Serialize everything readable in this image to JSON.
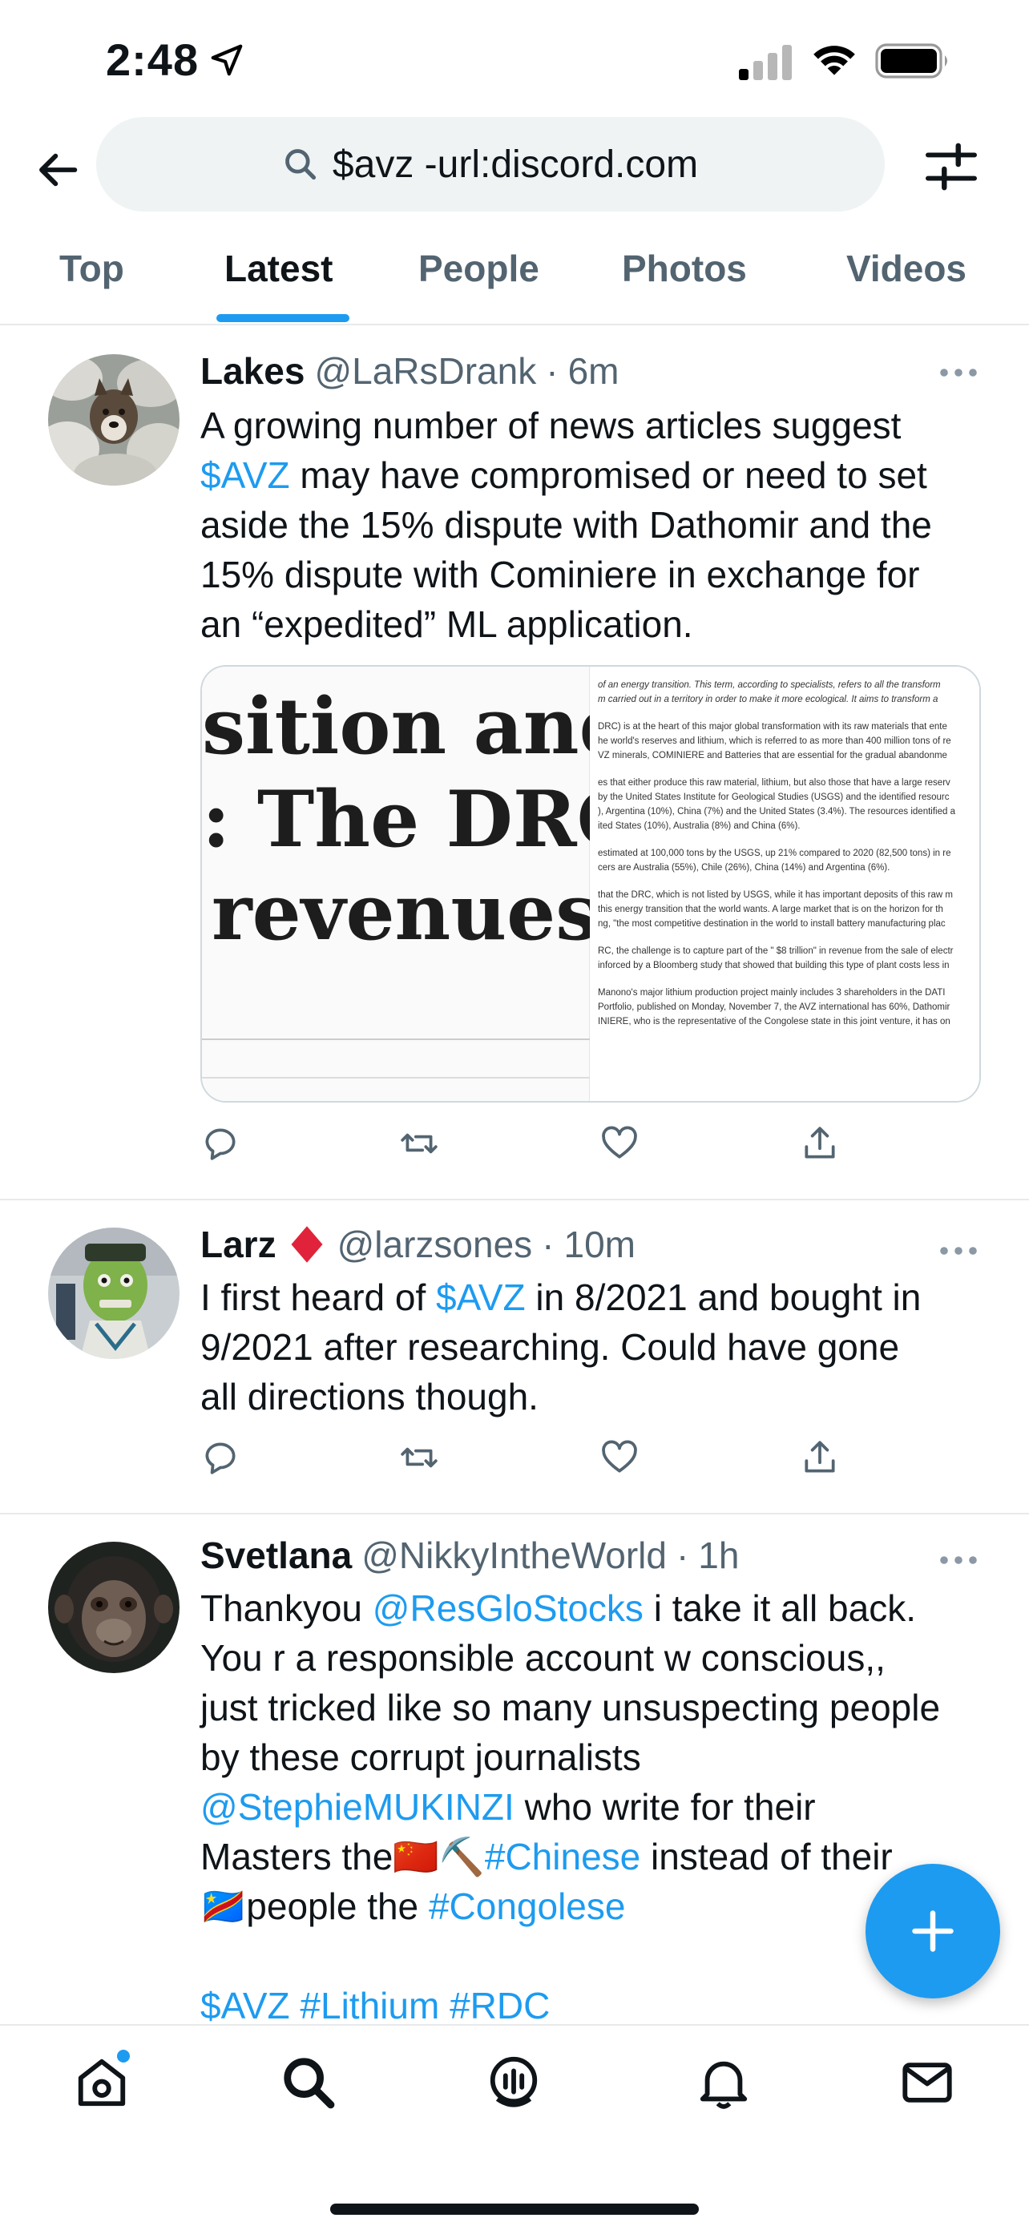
{
  "status_bar": {
    "time": "2:48",
    "icons": [
      "location-arrow-icon",
      "cellular-signal-icon",
      "wifi-icon",
      "battery-icon"
    ]
  },
  "search": {
    "query": "$avz -url:discord.com"
  },
  "tabs": [
    {
      "label": "Top",
      "active": false
    },
    {
      "label": "Latest",
      "active": true
    },
    {
      "label": "People",
      "active": false
    },
    {
      "label": "Photos",
      "active": false
    },
    {
      "label": "Videos",
      "active": false
    }
  ],
  "colors": {
    "accent": "#1d9bf0",
    "text": "#0f1419",
    "secondary": "#536471",
    "divider": "#e7e9ea",
    "search_bg": "#eff3f4"
  },
  "tweets": [
    {
      "name": "Lakes",
      "handle": "@LaRsDrank",
      "separator": "·",
      "time": "6m",
      "body": {
        "l1": "A growing number of news articles suggest",
        "l2_link": "$AVZ",
        "l2": " may have compromised or need to set",
        "l3": "aside the 15% dispute with Dathomir and the",
        "l4": "15% dispute with Cominiere in exchange for",
        "l5": "an “expedited” ML application."
      },
      "media": {
        "headline_1": "sition and",
        "headline_2": ": The DRC",
        "headline_3": "revenues",
        "article": [
          "of an energy transition. This term, according to specialists, refers to all the transform",
          "m carried out in a territory in order to make it more ecological. It aims to transform a",
          "DRC) is at the heart of this major global transformation with its raw materials that ente",
          "he world's reserves and lithium, which is referred to as more than 400 million tons of re",
          "VZ minerals, COMINIERE and Batteries that are essential for the gradual abandonme",
          "es that either produce this raw material, lithium, but also those that have a large reserv",
          "by the United States Institute for Geological Studies (USGS) and the identified resourc",
          "), Argentina (10%), China (7%) and the United States (3.4%). The resources identified a",
          "ited States (10%), Australia (8%) and China (6%).",
          "estimated at 100,000 tons by the USGS, up 21% compared to 2020 (82,500 tons) in re",
          "cers are Australia (55%), Chile (26%), China (14%) and Argentina (6%).",
          "that the DRC, which is not listed by USGS, while it has important deposits of this raw m",
          "this energy transition that the world wants. A large market that is on the horizon for th",
          "ng, \"the most competitive destination in the world to install battery manufacturing plac",
          "RC, the challenge is to capture part of the \" $8 trillion\" in revenue from the sale of electr",
          "inforced by a Bloomberg study that showed that building this type of plant costs less in",
          "Manono's major lithium production project mainly includes 3 shareholders in the DATI",
          "Portfolio, published on Monday, November 7, the AVZ international has 60%, Dathomir",
          "INIERE, who is the representative of the Congolese state in this joint venture, it has on"
        ]
      }
    },
    {
      "name": "Larz",
      "badge_emoji": "♦️",
      "handle": "@larzsones",
      "separator": "·",
      "time": "10m",
      "body": {
        "l1_pre": "I first heard of ",
        "l1_link": "$AVZ",
        "l1_post": " in 8/2021 and bought in",
        "l2": "9/2021 after researching. Could have gone",
        "l3": "all directions though."
      }
    },
    {
      "name": "Svetlana",
      "handle": "@NikkyIntheWorld",
      "separator": "·",
      "time": "1h",
      "body": {
        "l1_pre": "Thankyou ",
        "l1_link": "@ResGloStocks",
        "l1_post": " i take it all back.",
        "l2": "You r a responsible account w conscious,,",
        "l3": "just tricked like so many unsuspecting people",
        "l4": "by these corrupt journalists",
        "l5_link": "@StephieMUKINZI",
        "l5_post": " who write for their",
        "l6_pre": "Masters the",
        "l6_emoji": "🇨🇳⛏️",
        "l6_link": "#Chinese",
        "l6_post": " instead of their",
        "l7_emoji": "🇨🇩",
        "l7_pre": "people the ",
        "l7_link": "#Congolese",
        "l8_link1": "$AVZ",
        "l8_link2": "#Lithium",
        "l8_link3": "#RDC"
      }
    }
  ],
  "bottom_nav": [
    "home-icon",
    "search-icon",
    "spaces-icon",
    "notifications-icon",
    "messages-icon"
  ]
}
